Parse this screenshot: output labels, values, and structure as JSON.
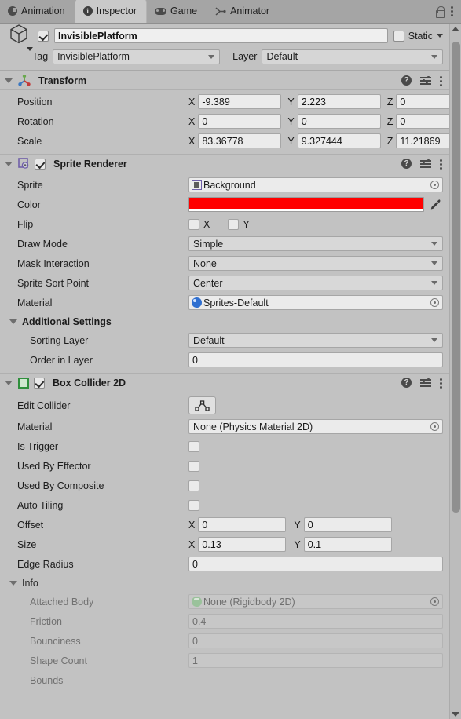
{
  "tabs": [
    {
      "label": "Animation",
      "icon": "clock-icon",
      "active": false
    },
    {
      "label": "Inspector",
      "icon": "info-icon",
      "active": true
    },
    {
      "label": "Game",
      "icon": "gamepad-icon",
      "active": false
    },
    {
      "label": "Animator",
      "icon": "animator-node-icon",
      "active": false
    }
  ],
  "tabbar_tools": {
    "lock": "lock-icon",
    "menu": "kebab-menu-icon"
  },
  "gameobject": {
    "enabled": true,
    "name": "InvisiblePlatform",
    "static_label": "Static",
    "static_checked": false,
    "tag_label": "Tag",
    "tag_value": "InvisiblePlatform",
    "layer_label": "Layer",
    "layer_value": "Default"
  },
  "transform": {
    "title": "Transform",
    "expanded": true,
    "rows": [
      {
        "label": "Position",
        "x": "-9.389",
        "y": "2.223",
        "z": "0"
      },
      {
        "label": "Rotation",
        "x": "0",
        "y": "0",
        "z": "0"
      },
      {
        "label": "Scale",
        "x": "83.36778",
        "y": "9.327444",
        "z": "11.21869"
      }
    ],
    "axes": {
      "x": "X",
      "y": "Y",
      "z": "Z"
    }
  },
  "sprite_renderer": {
    "title": "Sprite Renderer",
    "enabled": true,
    "expanded": true,
    "sprite_label": "Sprite",
    "sprite_value": "Background",
    "color_label": "Color",
    "color_value": "#ff0000",
    "color_alpha_value": "#ffffff",
    "flip_label": "Flip",
    "flip_x_label": "X",
    "flip_y_label": "Y",
    "flip_x_checked": false,
    "flip_y_checked": false,
    "draw_mode_label": "Draw Mode",
    "draw_mode_value": "Simple",
    "mask_interaction_label": "Mask Interaction",
    "mask_interaction_value": "None",
    "sort_point_label": "Sprite Sort Point",
    "sort_point_value": "Center",
    "material_label": "Material",
    "material_value": "Sprites-Default",
    "additional_settings_label": "Additional Settings",
    "sorting_layer_label": "Sorting Layer",
    "sorting_layer_value": "Default",
    "order_in_layer_label": "Order in Layer",
    "order_in_layer_value": "0"
  },
  "box_collider_2d": {
    "title": "Box Collider 2D",
    "enabled": true,
    "expanded": true,
    "edit_collider_label": "Edit Collider",
    "material_label": "Material",
    "material_value": "None (Physics Material 2D)",
    "is_trigger_label": "Is Trigger",
    "is_trigger_checked": false,
    "used_by_effector_label": "Used By Effector",
    "used_by_effector_checked": false,
    "used_by_composite_label": "Used By Composite",
    "used_by_composite_checked": false,
    "auto_tiling_label": "Auto Tiling",
    "auto_tiling_checked": false,
    "offset_label": "Offset",
    "offset_x": "0",
    "offset_y": "0",
    "size_label": "Size",
    "size_x": "0.13",
    "size_y": "0.1",
    "edge_radius_label": "Edge Radius",
    "edge_radius_value": "0",
    "info_label": "Info",
    "info": [
      {
        "label": "Attached Body",
        "value": "None (Rigidbody 2D)",
        "type": "object"
      },
      {
        "label": "Friction",
        "value": "0.4",
        "type": "text"
      },
      {
        "label": "Bounciness",
        "value": "0",
        "type": "text"
      },
      {
        "label": "Shape Count",
        "value": "1",
        "type": "text"
      },
      {
        "label": "Bounds",
        "value": "",
        "type": "text"
      }
    ],
    "axes": {
      "x": "X",
      "y": "Y"
    }
  },
  "component_tools": {
    "help": "help-icon",
    "preset": "preset-icon",
    "menu": "kebab-menu-icon"
  }
}
